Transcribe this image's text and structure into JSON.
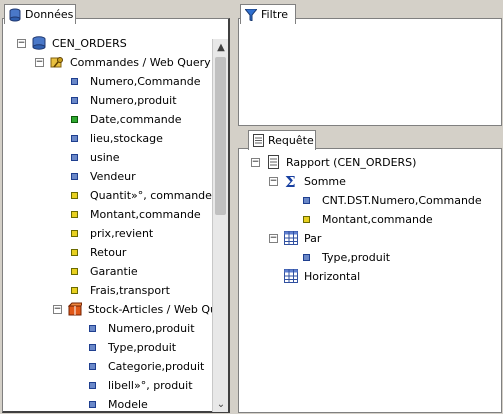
{
  "tabs": {
    "donnees": "Données",
    "filtre": "Filtre",
    "requete": "Requête"
  },
  "donnees_tree": {
    "root": "CEN_ORDERS",
    "commandes": "Commandes / Web Query",
    "commandes_fields": [
      {
        "label": "Numero,Commande",
        "color": "blue"
      },
      {
        "label": "Numero,produit",
        "color": "blue"
      },
      {
        "label": "Date,commande",
        "color": "green"
      },
      {
        "label": "lieu,stockage",
        "color": "blue"
      },
      {
        "label": "usine",
        "color": "blue"
      },
      {
        "label": "Vendeur",
        "color": "blue"
      },
      {
        "label": "Quantit»°, commande",
        "color": "yellow"
      },
      {
        "label": "Montant,commande",
        "color": "yellow"
      },
      {
        "label": "prix,revient",
        "color": "yellow"
      },
      {
        "label": "Retour",
        "color": "yellow"
      },
      {
        "label": "Garantie",
        "color": "yellow"
      },
      {
        "label": "Frais,transport",
        "color": "yellow"
      }
    ],
    "stock": "Stock-Articles / Web Que",
    "stock_fields": [
      {
        "label": "Numero,produit",
        "color": "blue"
      },
      {
        "label": "Type,produit",
        "color": "blue"
      },
      {
        "label": "Categorie,produit",
        "color": "blue"
      },
      {
        "label": "libell»°, produit",
        "color": "blue"
      },
      {
        "label": "Modele",
        "color": "blue"
      }
    ]
  },
  "requete_tree": {
    "rapport": "Rapport (CEN_ORDERS)",
    "somme": "Somme",
    "somme_fields": [
      {
        "label": "CNT.DST.Numero,Commande",
        "color": "blue"
      },
      {
        "label": "Montant,commande",
        "color": "yellow"
      }
    ],
    "par": "Par",
    "par_fields": [
      {
        "label": "Type,produit",
        "color": "blue"
      }
    ],
    "horizontal": "Horizontal"
  },
  "expander_symbols": {
    "expanded": "−"
  },
  "icons": {
    "donnees": "database-icon",
    "filtre": "funnel-icon",
    "requete": "document-icon",
    "commandes": "folder-key-icon",
    "stock": "package-icon",
    "somme": "sigma-icon",
    "par": "grid-icon",
    "horizontal": "grid-icon"
  }
}
